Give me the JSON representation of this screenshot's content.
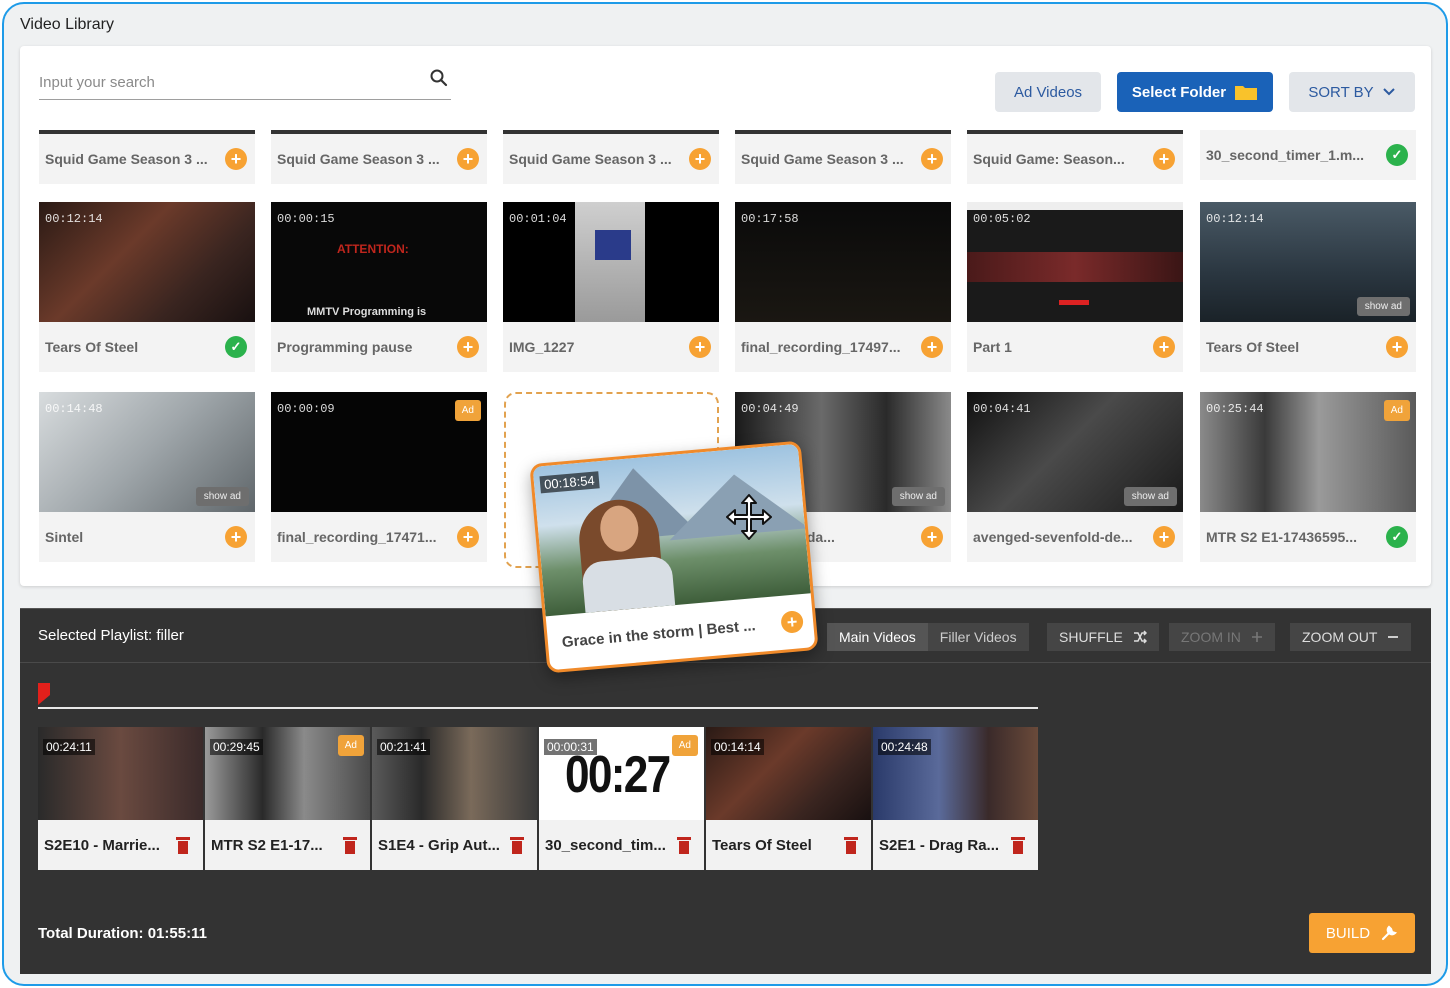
{
  "app": {
    "title": "Video Library"
  },
  "search": {
    "placeholder": "Input your search"
  },
  "toolbar": {
    "ad_videos_label": "Ad Videos",
    "select_folder_label": "Select Folder",
    "sort_by_label": "SORT BY"
  },
  "library": {
    "row1": [
      {
        "title": "Squid Game Season 3 ...",
        "status": "add"
      },
      {
        "title": "Squid Game Season 3 ...",
        "status": "add"
      },
      {
        "title": "Squid Game Season 3 ...",
        "status": "add"
      },
      {
        "title": "Squid Game Season 3 ...",
        "status": "add"
      },
      {
        "title": "Squid Game:  Season...",
        "status": "add"
      },
      {
        "title": "30_second_timer_1.m...",
        "status": "added"
      }
    ],
    "row2": [
      {
        "time": "00:12:14",
        "title": "Tears Of Steel",
        "status": "added"
      },
      {
        "time": "00:00:15",
        "title": "Programming pause",
        "status": "add",
        "overlay_top": "ATTENTION:",
        "overlay_bottom": "MMTV Programming is"
      },
      {
        "time": "00:01:04",
        "title": "IMG_1227",
        "status": "add"
      },
      {
        "time": "00:17:58",
        "title": "final_recording_17497...",
        "status": "add"
      },
      {
        "time": "00:05:02",
        "title": "Part 1",
        "status": "add"
      },
      {
        "time": "00:12:14",
        "title": "Tears Of Steel",
        "status": "add",
        "badge": "show ad"
      }
    ],
    "row3": [
      {
        "time": "00:14:48",
        "title": "Sintel",
        "status": "add",
        "badge": "show ad"
      },
      {
        "time": "00:00:09",
        "title": "final_recording_17471...",
        "status": "add",
        "tag": "Ad"
      },
      {
        "time": "00:04:49",
        "title": "n Wednesda...",
        "status": "add",
        "badge": "show ad"
      },
      {
        "time": "00:04:41",
        "title": "avenged-sevenfold-de...",
        "status": "add",
        "badge": "show ad"
      },
      {
        "time": "00:25:44",
        "title": "MTR S2 E1-17436595...",
        "status": "added",
        "tag": "Ad"
      }
    ]
  },
  "dragging": {
    "time": "00:18:54",
    "title": "Grace in the storm  |  Best ..."
  },
  "playlist": {
    "label": "Selected Playlist: filler",
    "tabs": [
      "Main Videos",
      "Filler Videos"
    ],
    "shuffle_label": "SHUFFLE",
    "zoom_in_label": "ZOOM IN",
    "zoom_out_label": "ZOOM OUT",
    "items": [
      {
        "time": "00:24:11",
        "title": "S2E10 - Marrie..."
      },
      {
        "time": "00:29:45",
        "title": "MTR S2 E1-17...",
        "tag": "Ad"
      },
      {
        "time": "00:21:41",
        "title": "S1E4 - Grip Aut..."
      },
      {
        "time": "00:00:31",
        "title": "30_second_tim...",
        "tag": "Ad",
        "big_text": "00:27"
      },
      {
        "time": "00:14:14",
        "title": "Tears Of Steel"
      },
      {
        "time": "00:24:48",
        "title": "S2E1 - Drag Ra..."
      }
    ],
    "total_duration": "Total Duration: 01:55:11",
    "build_label": "BUILD"
  },
  "colors": {
    "frame_border": "#1e9be8",
    "primary": "#1a62b8",
    "accent": "#f7a233",
    "success": "#2bb24c",
    "dark_panel": "#333333"
  },
  "icons": [
    "search-icon",
    "folder-icon",
    "chevron-down-icon",
    "plus-circle-icon",
    "check-circle-icon",
    "shuffle-icon",
    "plus-icon",
    "minus-icon",
    "trash-icon",
    "wrench-icon",
    "move-icon",
    "playhead-marker-icon"
  ]
}
